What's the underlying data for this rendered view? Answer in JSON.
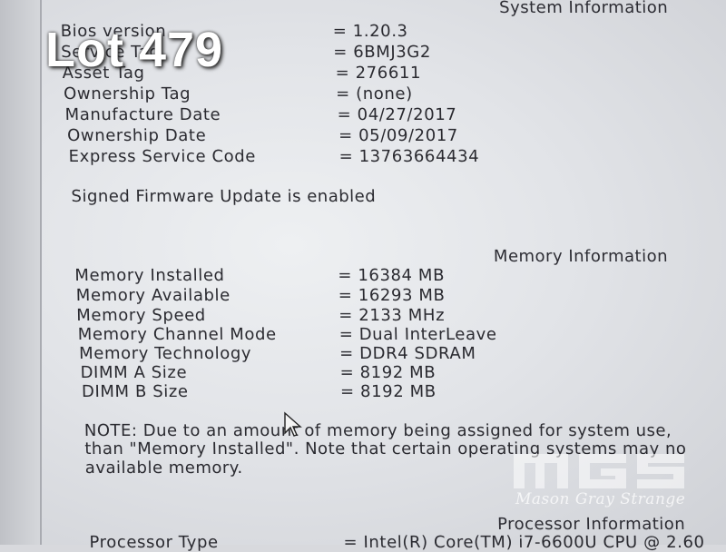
{
  "overlay": {
    "lot_label": "Lot 479"
  },
  "system_information": {
    "heading": "System Information",
    "rows": [
      {
        "label": "Bios version",
        "value": "= 1.20.3"
      },
      {
        "label": "Service Tag",
        "value": "= 6BMJ3G2"
      },
      {
        "label": "Asset Tag",
        "value": "= 276611"
      },
      {
        "label": "Ownership Tag",
        "value": "= (none)"
      },
      {
        "label": "Manufacture Date",
        "value": "= 04/27/2017"
      },
      {
        "label": "Ownership Date",
        "value": "= 05/09/2017"
      },
      {
        "label": "Express Service Code",
        "value": "= 13763664434"
      }
    ],
    "firmware_note": "Signed Firmware Update is enabled"
  },
  "memory_information": {
    "heading": "Memory Information",
    "rows": [
      {
        "label": "Memory Installed",
        "value": "= 16384 MB"
      },
      {
        "label": "Memory Available",
        "value": "= 16293 MB"
      },
      {
        "label": "Memory Speed",
        "value": "= 2133 MHz"
      },
      {
        "label": "Memory Channel Mode",
        "value": "= Dual InterLeave"
      },
      {
        "label": "Memory Technology",
        "value": "= DDR4 SDRAM"
      },
      {
        "label": "DIMM A Size",
        "value": "= 8192 MB"
      },
      {
        "label": "DIMM B Size",
        "value": "= 8192 MB"
      }
    ],
    "note_lines": [
      "NOTE: Due to an amount of memory being assigned for system use,",
      "than \"Memory Installed\". Note that certain operating systems may no",
      "available memory."
    ]
  },
  "processor_information": {
    "heading": "Processor Information",
    "rows": [
      {
        "label": "Processor Type",
        "value": "= Intel(R) Core(TM) i7-6600U CPU @ 2.60"
      }
    ]
  },
  "watermark": {
    "brand": "MGS",
    "text": "Mason Gray Strange"
  },
  "colors": {
    "screen": "#e4e6ea",
    "text": "#2a2a30",
    "overlay_text": "#ffffff"
  }
}
